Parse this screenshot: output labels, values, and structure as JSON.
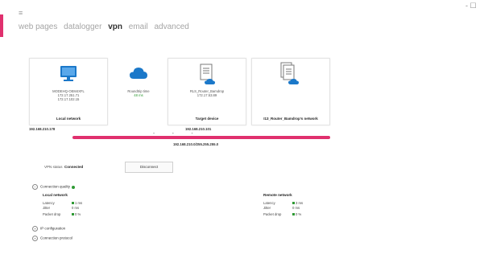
{
  "window": {
    "minimize_label": "- ☐"
  },
  "colors": {
    "accent": "#e0306e",
    "icon_blue": "#1b78c9"
  },
  "menu": {
    "items": [
      {
        "label": "web pages",
        "active": false
      },
      {
        "label": "datalogger",
        "active": false
      },
      {
        "label": "vpn",
        "active": true
      },
      {
        "label": "email",
        "active": false
      },
      {
        "label": "advanced",
        "active": false
      }
    ]
  },
  "tiles": {
    "local": {
      "icon": "monitor-icon",
      "lines": [
        "MODEHQ-OEM4XFL",
        "172.17.251.71",
        "172.17.102.15"
      ],
      "caption": "Local network"
    },
    "roundtrip": {
      "icon": "cloud-icon",
      "label": "Roundtrip time",
      "value": "48 ms"
    },
    "target": {
      "icon": "document-cloud-icon",
      "lines": [
        "RLS_Router_Bamdrop",
        "172.17.53.89"
      ],
      "caption": "Target device"
    },
    "remote": {
      "icon": "documents-cloud-icon",
      "caption": "I13_Router_Bamdrop's network"
    }
  },
  "ips": {
    "local": "192.168.210.178",
    "target": "192.168.210.101",
    "subnet": "192.168.210.0/255.255.255.0"
  },
  "status": {
    "label": "VPN status",
    "value": "Connected",
    "disconnect": "Disconnect"
  },
  "sections": {
    "quality": "Connection quality",
    "ip_config": "IP configuration",
    "protocol": "Connection protocol"
  },
  "local_network": {
    "title": "Local network",
    "metrics": [
      {
        "name": "Latency",
        "value": "1 ms"
      },
      {
        "name": "Jitter",
        "value": "0 ms"
      },
      {
        "name": "Packet drop",
        "value": "0 %"
      }
    ]
  },
  "remote_network": {
    "title": "Remote network",
    "metrics": [
      {
        "name": "Latency",
        "value": "3 ms"
      },
      {
        "name": "Jitter",
        "value": "0 ms"
      },
      {
        "name": "Packet drop",
        "value": "0 %"
      }
    ]
  }
}
